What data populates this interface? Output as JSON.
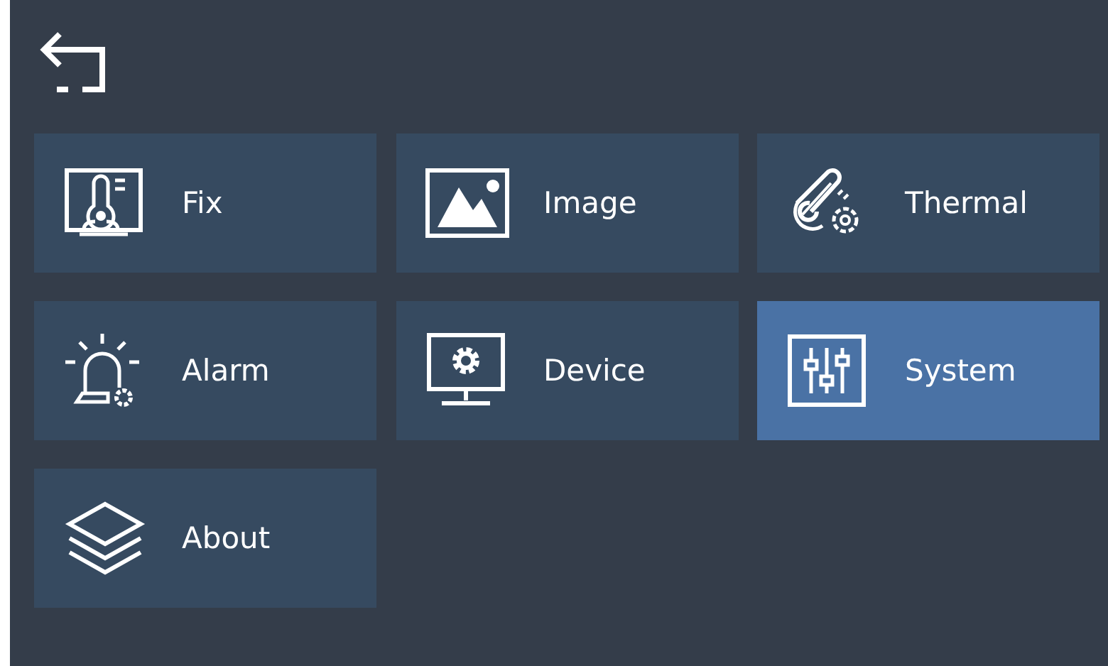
{
  "menu": [
    {
      "label": "Fix",
      "kind": "thermometer",
      "selected": false
    },
    {
      "label": "Image",
      "kind": "image",
      "selected": false
    },
    {
      "label": "Thermal",
      "kind": "thermal",
      "selected": false
    },
    {
      "label": "Alarm",
      "kind": "alarm",
      "selected": false
    },
    {
      "label": "Device",
      "kind": "device",
      "selected": false
    },
    {
      "label": "System",
      "kind": "sliders",
      "selected": true
    },
    {
      "label": "About",
      "kind": "layers",
      "selected": false
    }
  ]
}
